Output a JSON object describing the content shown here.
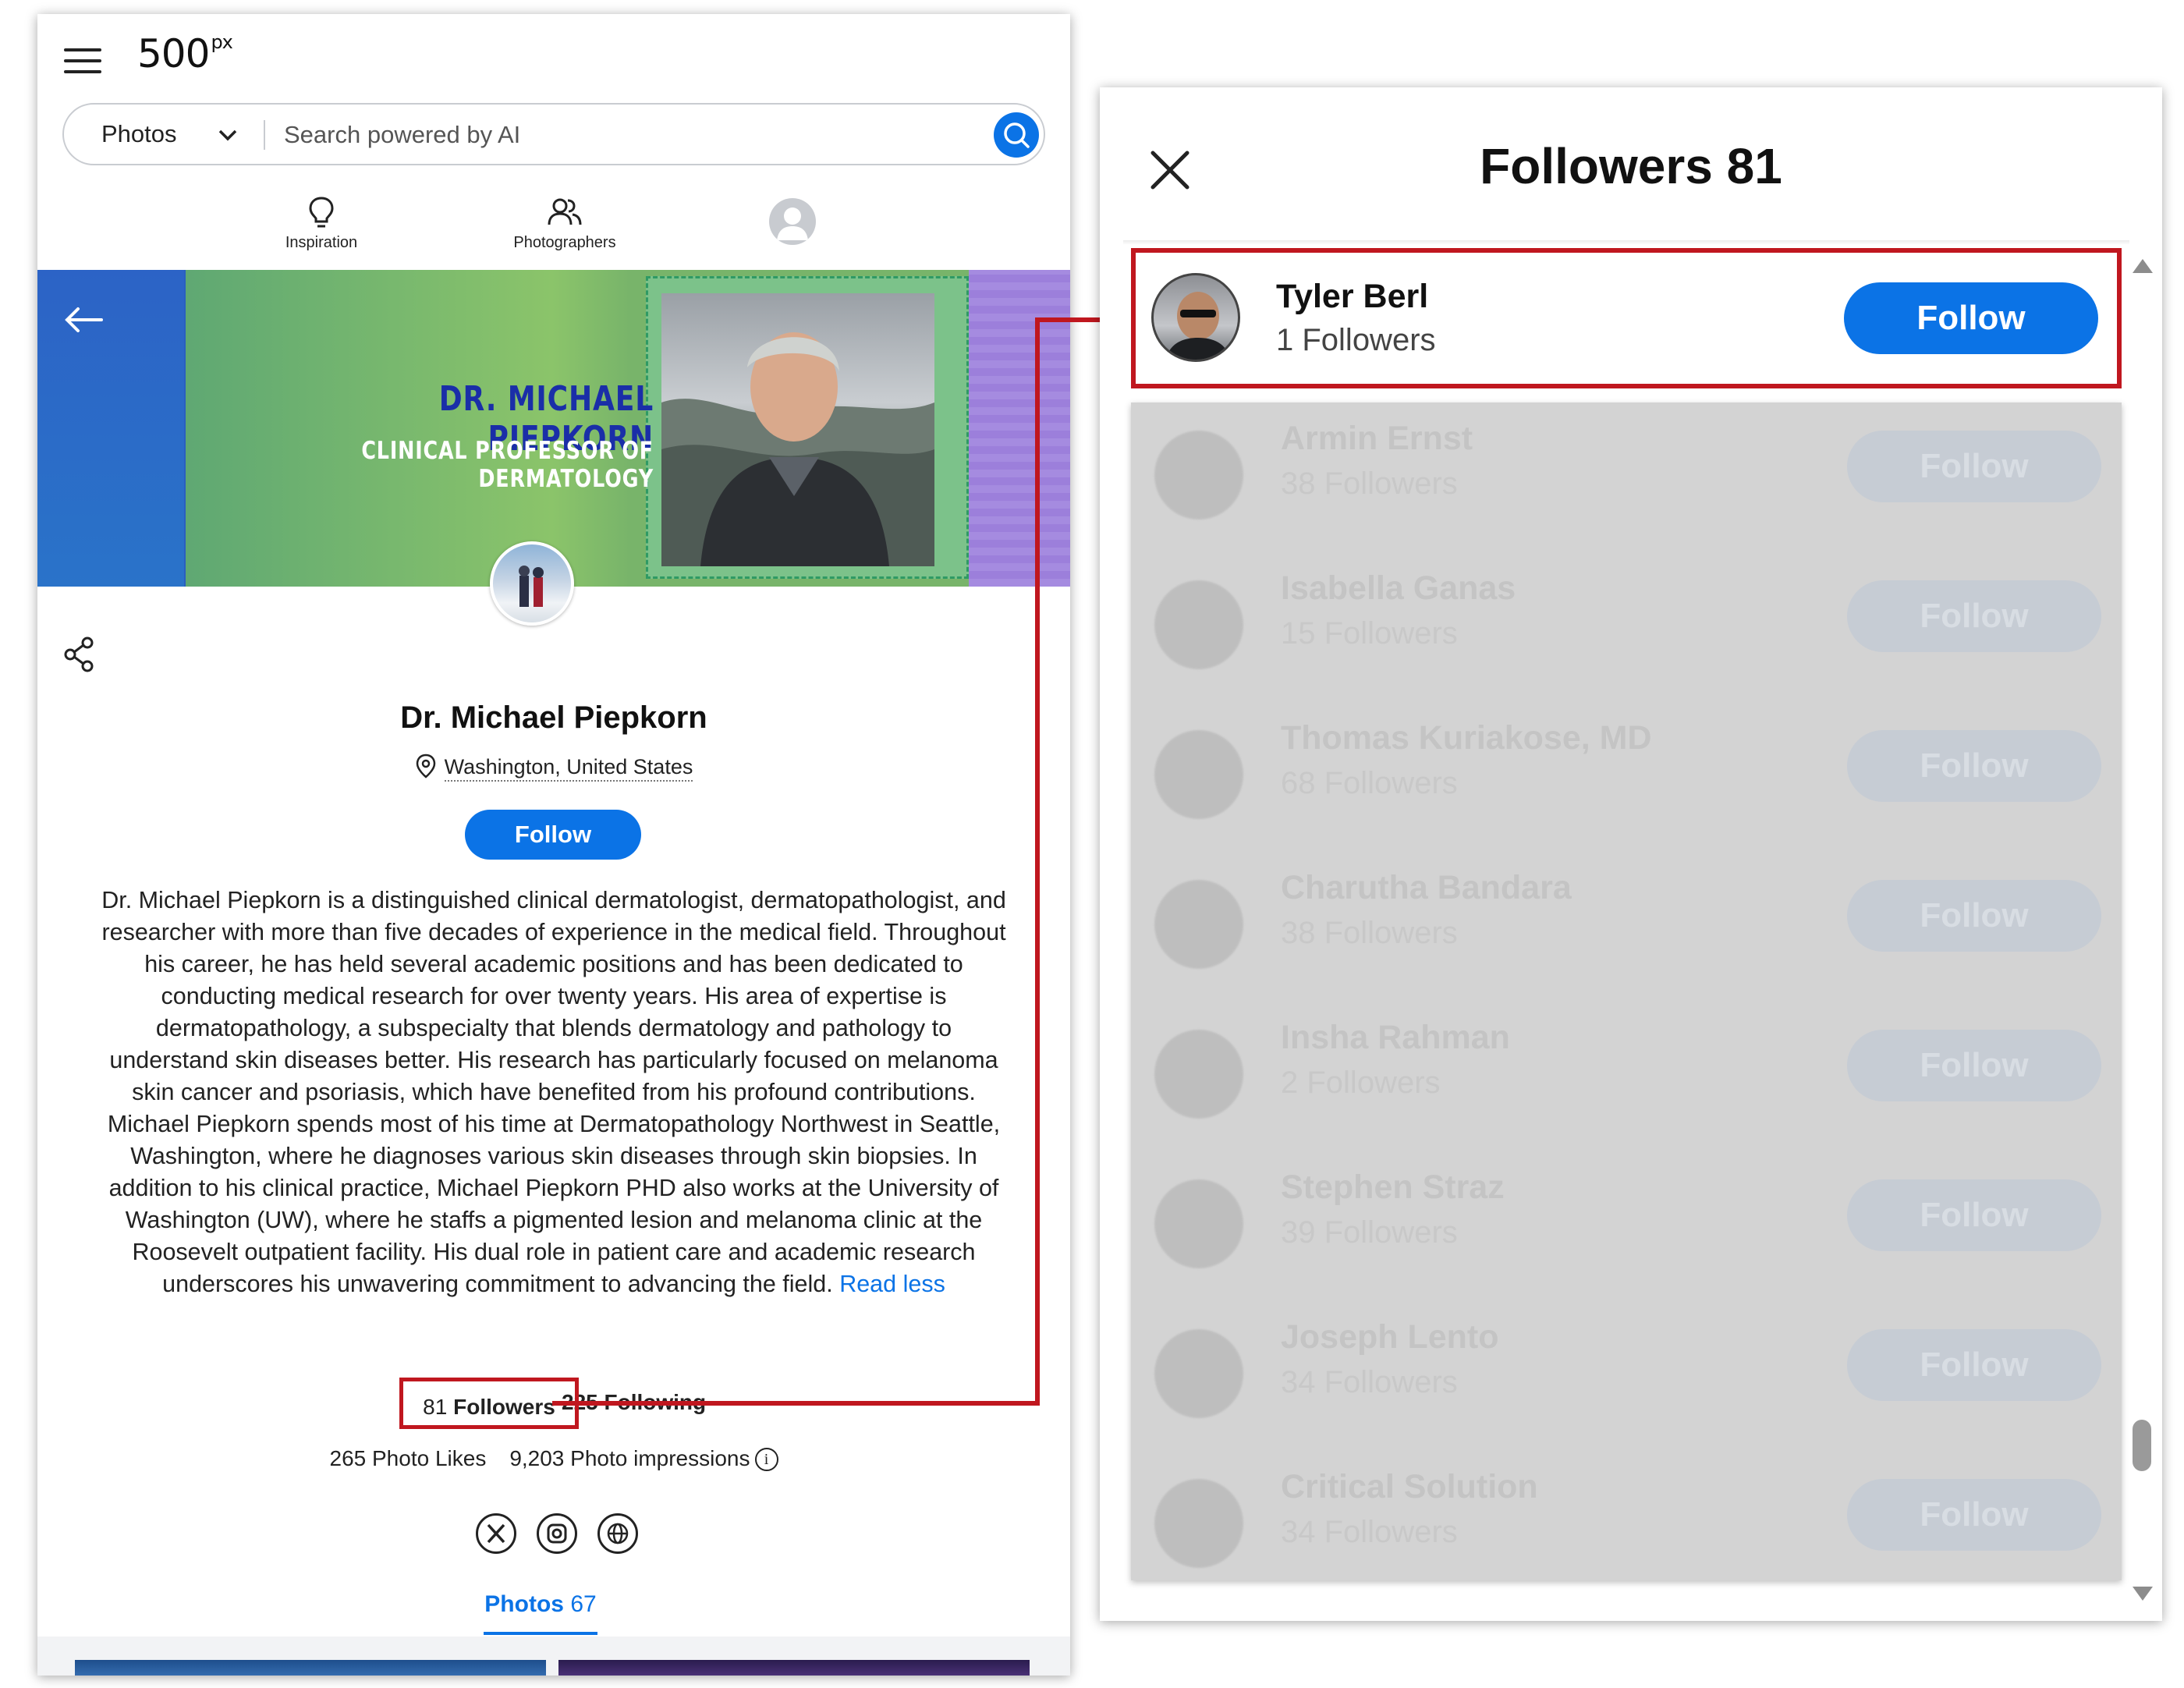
{
  "header": {
    "logo": "500",
    "logo_sup": "px",
    "search": {
      "category": "Photos",
      "placeholder": "Search powered by AI"
    },
    "nav": [
      {
        "label": "Inspiration",
        "icon": "lightbulb-icon"
      },
      {
        "label": "Photographers",
        "icon": "people-icon"
      },
      {
        "label": "",
        "icon": "user-avatar-icon"
      }
    ]
  },
  "banner": {
    "name": "DR. MICHAEL PIEPKORN",
    "title": "CLINICAL PROFESSOR OF DERMATOLOGY"
  },
  "profile": {
    "name": "Dr. Michael Piepkorn",
    "location": "Washington, United States",
    "follow_label": "Follow",
    "bio": "Dr. Michael Piepkorn is a distinguished clinical dermatologist, dermatopathologist, and researcher with more than five decades of experience in the medical field. Throughout his career, he has held several academic positions and has been dedicated to conducting medical research for over twenty years. His area of expertise is dermatopathology, a subspecialty that blends dermatology and pathology to understand skin diseases better. His research has particularly focused on melanoma skin cancer and psoriasis, which have benefited from his profound contributions. Michael Piepkorn spends most of his time at Dermatopathology Northwest in Seattle, Washington, where he diagnoses various skin diseases through skin biopsies. In addition to his clinical practice, Michael Piepkorn PHD also works at the University of Washington (UW), where he staffs a pigmented lesion and melanoma clinic at the Roosevelt outpatient facility. His dual role in patient care and academic research underscores his unwavering commitment to advancing the field.",
    "read_less": "Read less",
    "followers_count": "81",
    "followers_label": "Followers",
    "following_count": "225",
    "following_label": "Following",
    "photo_likes": "265 Photo Likes",
    "photo_impressions": "9,203 Photo impressions",
    "social_icons": [
      "x-icon",
      "instagram-icon",
      "globe-icon"
    ],
    "photos_tab_label": "Photos",
    "photos_tab_count": "67"
  },
  "modal": {
    "title": "Followers",
    "count": "81",
    "followers": [
      {
        "name": "Tyler Berl",
        "followers": "1 Followers",
        "button": "Follow"
      },
      {
        "name": "Armin Ernst",
        "followers": "38 Followers",
        "button": "Follow"
      },
      {
        "name": "Isabella Ganas",
        "followers": "15 Followers",
        "button": "Follow"
      },
      {
        "name": "Thomas Kuriakose, MD",
        "followers": "68 Followers",
        "button": "Follow"
      },
      {
        "name": "Charutha Bandara",
        "followers": "38 Followers",
        "button": "Follow"
      },
      {
        "name": "Insha Rahman",
        "followers": "2 Followers",
        "button": "Follow"
      },
      {
        "name": "Stephen Straz",
        "followers": "39 Followers",
        "button": "Follow"
      },
      {
        "name": "Joseph Lento",
        "followers": "34 Followers",
        "button": "Follow"
      },
      {
        "name": "Critical Solution",
        "followers": "34 Followers",
        "button": "Follow"
      }
    ]
  },
  "colors": {
    "accent": "#0b73e6",
    "highlight": "#c0171f",
    "banner_name": "#1a2ea8"
  }
}
